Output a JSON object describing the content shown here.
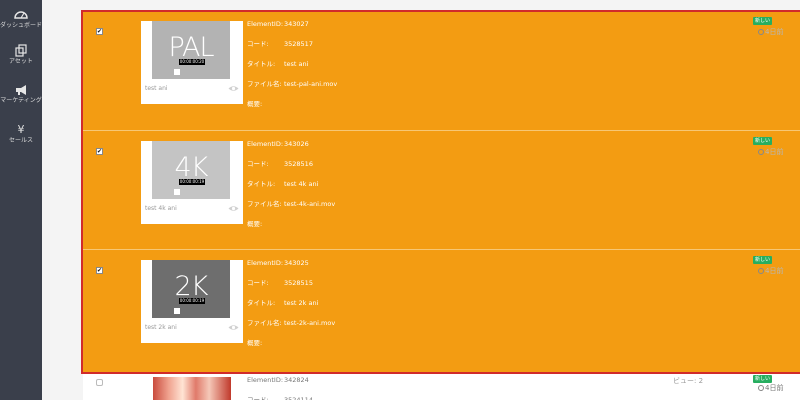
{
  "sidebar": {
    "items": [
      {
        "label": "ダッシュボード",
        "icon": "dashboard-icon"
      },
      {
        "label": "アセット",
        "icon": "copy-icon"
      },
      {
        "label": "マーケティング",
        "icon": "megaphone-icon"
      },
      {
        "label": "セールス",
        "icon": "yen-icon",
        "glyph": "¥"
      }
    ]
  },
  "fields": {
    "element_id": "ElementID:",
    "code": "コード:",
    "title": "タイトル:",
    "filename": "ファイル名:",
    "description": "概要:"
  },
  "rows": [
    {
      "checked": "✔",
      "thumb_text": "PAL",
      "timecode": "00:00:00:20",
      "thumb_color": "#b3b3b3",
      "card_name": "test ani",
      "element_id": "343027",
      "code": "3528517",
      "title": "test ani",
      "filename": "test-pal-ani.mov",
      "badge": "新しい",
      "ago": "4日前"
    },
    {
      "checked": "✔",
      "thumb_text": "4K",
      "timecode": "00:00:00:19",
      "thumb_color": "#c4c4c4",
      "card_name": "test 4k ani",
      "element_id": "343026",
      "code": "3528516",
      "title": "test 4k ani",
      "filename": "test-4k-ani.mov",
      "badge": "新しい",
      "ago": "4日前"
    },
    {
      "checked": "✔",
      "thumb_text": "2K",
      "timecode": "00:00:00:19",
      "thumb_color": "#6e6e6e",
      "card_name": "test 2k ani",
      "element_id": "343025",
      "code": "3528515",
      "title": "test 2k ani",
      "filename": "test-2k-ani.mov",
      "badge": "新しい",
      "ago": "4日前"
    },
    {
      "checked": "",
      "element_id": "342824",
      "code": "3524114",
      "views": "ビュー: 2",
      "badge": "新しい",
      "ago": "4日前"
    }
  ],
  "colors": {
    "selected_row": "#f39c12",
    "selection_border": "#d12b2b",
    "badge": "#27ae60",
    "sidebar": "#3a3f4b"
  }
}
